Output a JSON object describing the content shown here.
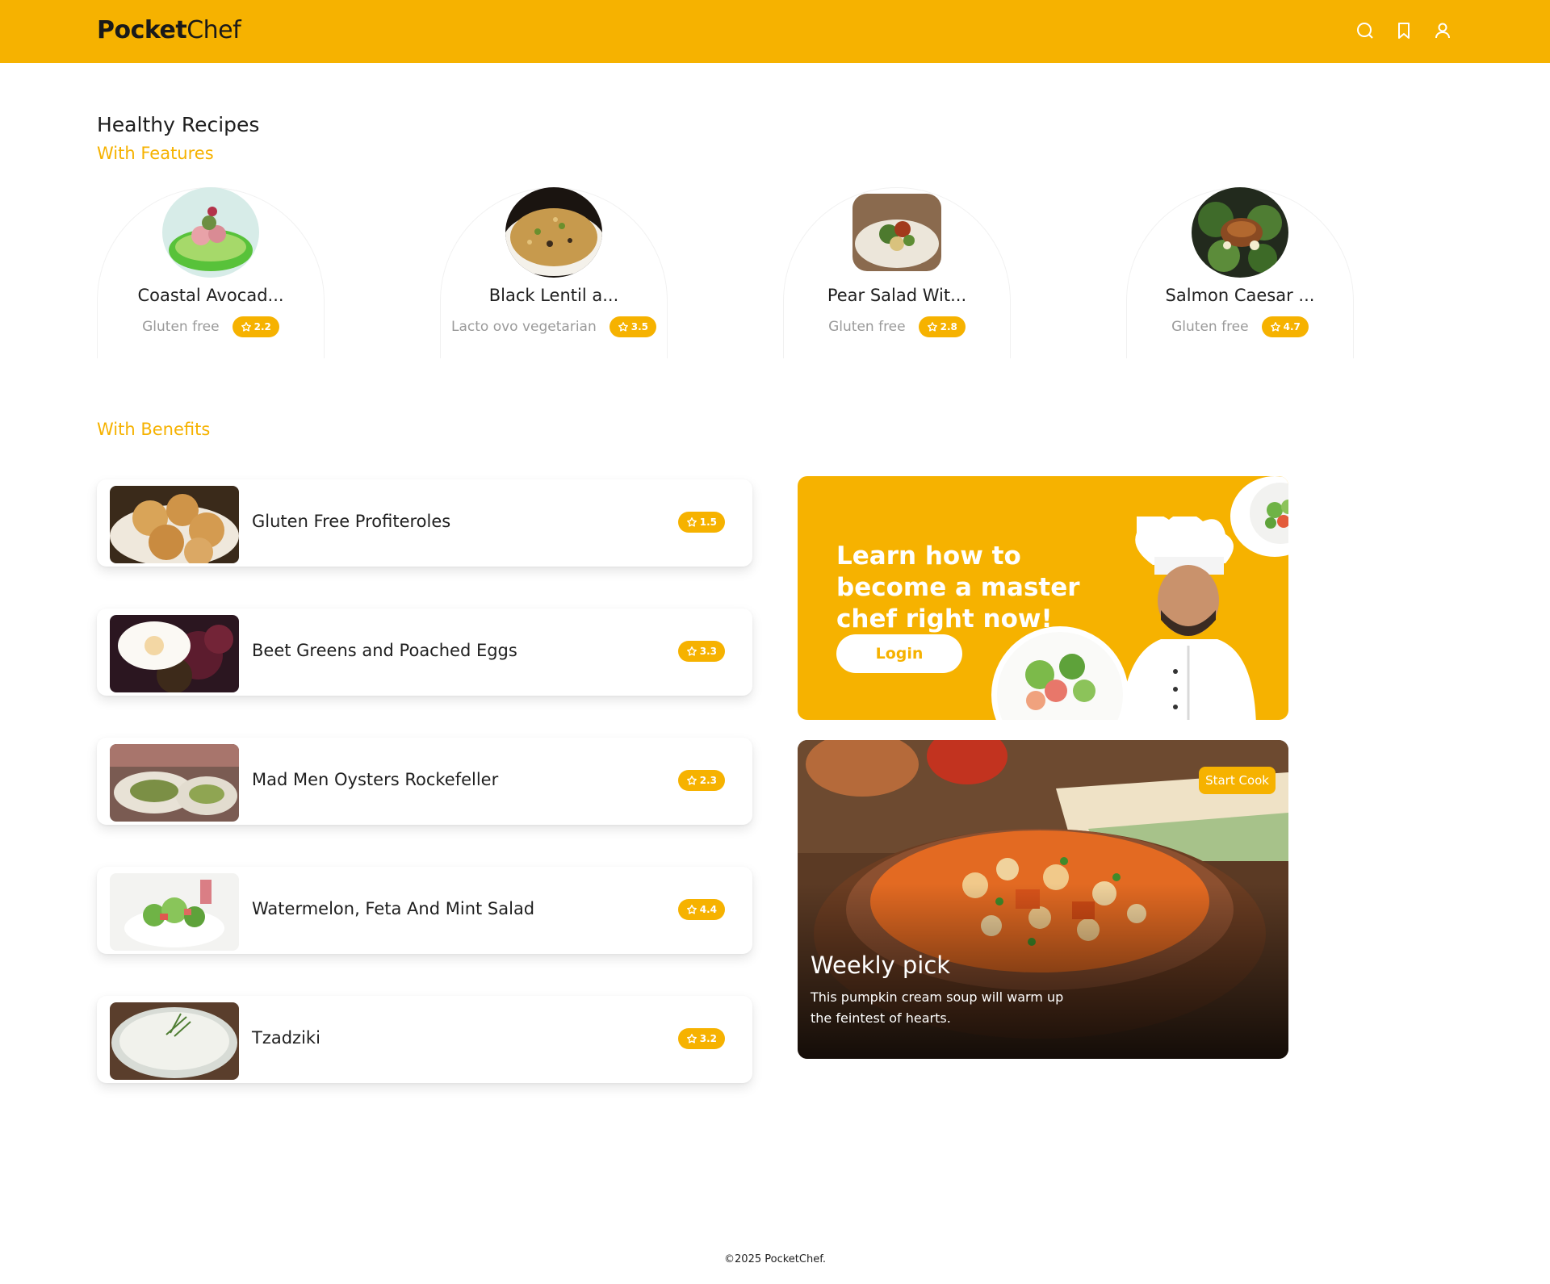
{
  "brand": {
    "part1": "Pocket",
    "part2": "Chef"
  },
  "header": {
    "icons": [
      "search-icon",
      "bookmark-icon",
      "user-icon"
    ]
  },
  "colors": {
    "accent": "#f6b200",
    "text": "#1f1f1f",
    "muted": "#9a9a9a"
  },
  "sections": {
    "title": "Healthy Recipes",
    "features_label": "With Features",
    "benefits_label": "With Benefits"
  },
  "featured": [
    {
      "name": "Coastal Avocad...",
      "diet": "Gluten free",
      "rating": "2.2"
    },
    {
      "name": "Black Lentil a...",
      "diet": "Lacto ovo vegetarian",
      "rating": "3.5"
    },
    {
      "name": "Pear Salad Wit...",
      "diet": "Gluten free",
      "rating": "2.8"
    },
    {
      "name": "Salmon Caesar ...",
      "diet": "Gluten free",
      "rating": "4.7"
    }
  ],
  "benefits": [
    {
      "title": "Gluten Free Profiteroles",
      "rating": "1.5"
    },
    {
      "title": "Beet Greens and Poached Eggs",
      "rating": "3.3"
    },
    {
      "title": "Mad Men Oysters Rockefeller",
      "rating": "2.3"
    },
    {
      "title": "Watermelon, Feta And Mint Salad",
      "rating": "4.4"
    },
    {
      "title": "Tzadziki",
      "rating": "3.2"
    }
  ],
  "promo": {
    "text": "Learn how to become a master chef right now!",
    "button": "Login"
  },
  "weekly": {
    "badge": "Start Cook",
    "title": "Weekly pick",
    "description": "This pumpkin cream soup will warm up the feintest of hearts."
  },
  "footer": "©2025 PocketChef."
}
